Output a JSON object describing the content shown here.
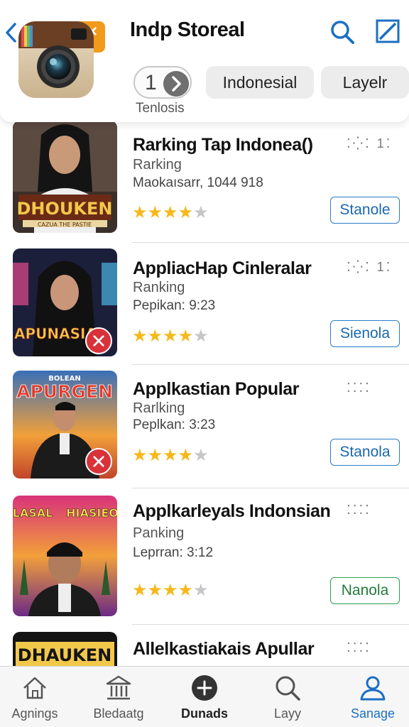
{
  "header": {
    "title": "Indp Storeal",
    "pager_number": "1",
    "pager_caption": "Tenlosis",
    "chips": [
      "Indonesial",
      "Layelr"
    ]
  },
  "apps": [
    {
      "name": "Rarking Tap Indonea()",
      "category": "Rarking",
      "meta": "Maokaısarr, 1044 918",
      "rating": 4,
      "button": "Stanole",
      "dots": "⁚⁛⁚ 1⁚",
      "thumb_text": "DHOUKEN",
      "thumb_subtext": "CAZUA THE PASTIE"
    },
    {
      "name": "AppliacHap Cinleralar",
      "category": "Ranking",
      "meta": "Pepikan: 9:23",
      "rating": 4,
      "button": "Sienola",
      "dots": "⁚⁛⁚ 1⁚",
      "thumb_text": "APUNASIA"
    },
    {
      "name": "Applkastian Popular",
      "category": "Rarlking",
      "meta": "Peplkan: 3:23",
      "rating": 4,
      "button": "Stanola",
      "dots": "⁚⁚⁚⁚",
      "thumb_text": "APURGEN",
      "thumb_subtext": "BOLEAN"
    },
    {
      "name": "Applkarleyals Indonsian",
      "category": "Panking",
      "meta": "Leprran: 3:12",
      "rating": 4,
      "button": "Nanola",
      "dots": "⁚⁚⁚⁚",
      "thumb_text": "LASAL",
      "thumb_text2": "HIASIEO"
    },
    {
      "name": "Allelkastiakais Apullar",
      "category": "",
      "meta": "",
      "rating": 0,
      "button": "",
      "dots": "⁚⁚⁚⁚",
      "thumb_text": "DHAUKEN"
    }
  ],
  "nav": [
    {
      "label": "Agnings",
      "icon": "home-icon"
    },
    {
      "label": "Bledaatg",
      "icon": "building-icon"
    },
    {
      "label": "Dunads",
      "icon": "add-circle-icon"
    },
    {
      "label": "Layy",
      "icon": "search-icon"
    },
    {
      "label": "Sanage",
      "icon": "person-icon"
    }
  ],
  "colors": {
    "accent": "#1c6fc2",
    "star": "#f6b81a",
    "remove": "#d9323a",
    "green": "#2f9e4f"
  }
}
